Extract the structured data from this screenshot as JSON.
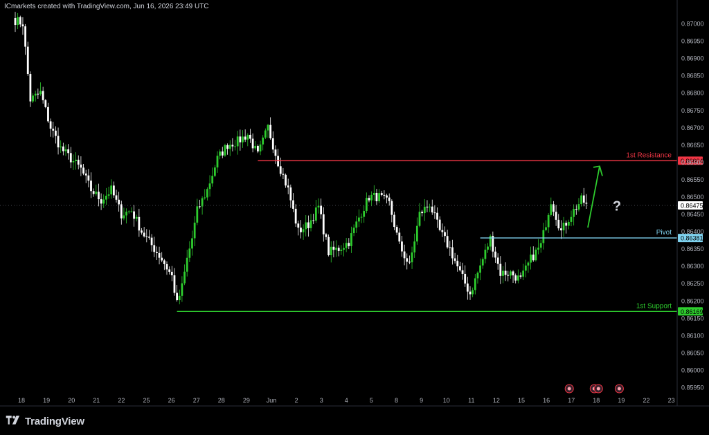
{
  "header": {
    "attribution": "ICmarkets created with TradingView.com, Jun 16, 2026 23:49 UTC"
  },
  "brand": {
    "name": "TradingView"
  },
  "colors": {
    "background": "#000000",
    "up_candle": "#2ecc2e",
    "down_candle": "#ffffff",
    "resistance": "#f23645",
    "support": "#2ecc2e",
    "pivot": "#7fd3f0",
    "current_price": "#ffffff",
    "arrow": "#2ecc2e"
  },
  "chart_data": {
    "type": "candlestick",
    "ylim": [
      0.8593,
      0.8704
    ],
    "y_ticks": [
      "0.87000",
      "0.86950",
      "0.86900",
      "0.86850",
      "0.86800",
      "0.86750",
      "0.86700",
      "0.86650",
      "0.86600",
      "0.86550",
      "0.86500",
      "0.86450",
      "0.86400",
      "0.86350",
      "0.86300",
      "0.86250",
      "0.86200",
      "0.86150",
      "0.86100",
      "0.86050",
      "0.86000",
      "0.85950"
    ],
    "x_ticks": [
      "18",
      "19",
      "20",
      "21",
      "22",
      "25",
      "26",
      "27",
      "28",
      "29",
      "Jun",
      "2",
      "3",
      "4",
      "5",
      "8",
      "9",
      "10",
      "11",
      "12",
      "15",
      "16",
      "17",
      "18",
      "19",
      "22",
      "23"
    ],
    "levels": [
      {
        "name": "1st Resistance",
        "value": 0.86604,
        "label": "0.86604",
        "start_index": 96
      },
      {
        "name": "Pivot",
        "value": 0.86381,
        "label": "0.86381",
        "start_index": 184
      },
      {
        "name": "1st Support",
        "value": 0.86169,
        "label": "0.86169",
        "start_index": 64
      }
    ],
    "current_price": {
      "value": 0.86475,
      "label": "0.86475"
    },
    "annotation": "?",
    "event_markers": [
      22,
      23,
      23,
      24
    ],
    "anchors": [
      [
        0,
        0.8701
      ],
      [
        3,
        0.87
      ],
      [
        6,
        0.8678
      ],
      [
        10,
        0.868
      ],
      [
        14,
        0.867
      ],
      [
        18,
        0.8664
      ],
      [
        22,
        0.8661
      ],
      [
        26,
        0.8658
      ],
      [
        30,
        0.8652
      ],
      [
        34,
        0.8649
      ],
      [
        38,
        0.8652
      ],
      [
        42,
        0.8645
      ],
      [
        46,
        0.8646
      ],
      [
        50,
        0.864
      ],
      [
        54,
        0.8636
      ],
      [
        58,
        0.8632
      ],
      [
        62,
        0.8627
      ],
      [
        64,
        0.8619
      ],
      [
        66,
        0.8624
      ],
      [
        68,
        0.8632
      ],
      [
        70,
        0.8638
      ],
      [
        72,
        0.8646
      ],
      [
        76,
        0.8652
      ],
      [
        80,
        0.8661
      ],
      [
        84,
        0.8665
      ],
      [
        88,
        0.8666
      ],
      [
        92,
        0.8668
      ],
      [
        96,
        0.8662
      ],
      [
        100,
        0.867
      ],
      [
        104,
        0.866
      ],
      [
        108,
        0.8652
      ],
      [
        112,
        0.864
      ],
      [
        116,
        0.8642
      ],
      [
        120,
        0.8647
      ],
      [
        124,
        0.8634
      ],
      [
        128,
        0.8635
      ],
      [
        132,
        0.8637
      ],
      [
        136,
        0.8644
      ],
      [
        140,
        0.865
      ],
      [
        144,
        0.865
      ],
      [
        148,
        0.8648
      ],
      [
        152,
        0.8636
      ],
      [
        156,
        0.863
      ],
      [
        160,
        0.8645
      ],
      [
        164,
        0.8648
      ],
      [
        168,
        0.864
      ],
      [
        172,
        0.8635
      ],
      [
        176,
        0.8628
      ],
      [
        180,
        0.8622
      ],
      [
        184,
        0.863
      ],
      [
        188,
        0.8638
      ],
      [
        192,
        0.8628
      ],
      [
        196,
        0.8628
      ],
      [
        200,
        0.8626
      ],
      [
        204,
        0.8632
      ],
      [
        208,
        0.8636
      ],
      [
        212,
        0.8649
      ],
      [
        216,
        0.864
      ],
      [
        220,
        0.8645
      ],
      [
        224,
        0.8649
      ],
      [
        226,
        0.8648
      ]
    ]
  }
}
